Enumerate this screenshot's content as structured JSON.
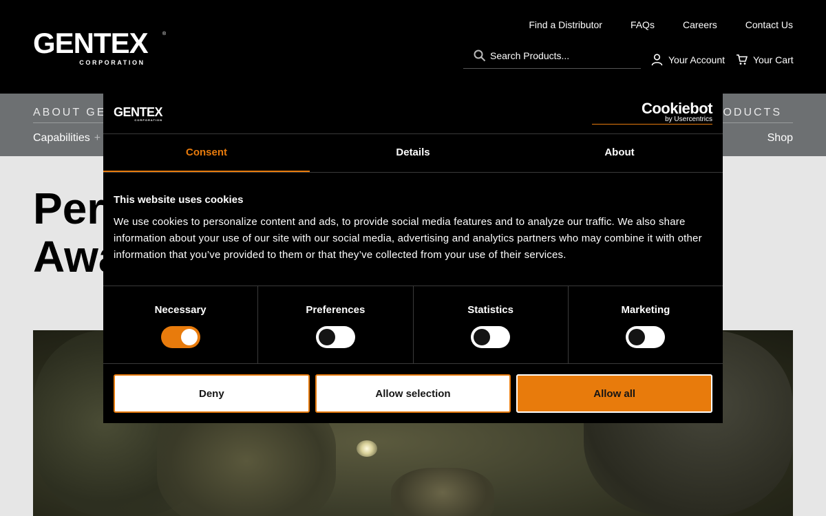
{
  "header": {
    "logo": {
      "word": "GENTEX",
      "sub": "CORPORATION",
      "reg": "®"
    },
    "utility_nav": [
      "Find a Distributor",
      "FAQs",
      "Careers",
      "Contact Us"
    ],
    "search": {
      "placeholder": "Search Products..."
    },
    "account_label": "Your Account",
    "cart_label": "Your Cart"
  },
  "nav": {
    "main_left": "ABOUT GE",
    "main_right": "ODUCTS",
    "sub_left": "Capabilities",
    "sub_left_plus": "+",
    "sub_right": "Shop"
  },
  "hero": {
    "title_line1": "Per",
    "title_line2": "Awa"
  },
  "cookie": {
    "logo": "GENTEX",
    "logo_sub": "CORPORATION",
    "brand": "Cookiebot",
    "brand_by": "by Usercentrics",
    "tabs": [
      "Consent",
      "Details",
      "About"
    ],
    "title": "This website uses cookies",
    "text": "We use cookies to personalize content and ads, to provide social media features and to analyze our traffic. We also share information about your use of our site with our social media, advertising and analytics partners who may combine it with other information that you’ve provided to them or that they’ve collected from your use of their services.",
    "toggles": [
      {
        "label": "Necessary",
        "on": true
      },
      {
        "label": "Preferences",
        "on": false
      },
      {
        "label": "Statistics",
        "on": false
      },
      {
        "label": "Marketing",
        "on": false
      }
    ],
    "buttons": {
      "deny": "Deny",
      "selection": "Allow selection",
      "allow_all": "Allow all"
    }
  },
  "colors": {
    "accent": "#e87b0c",
    "header_bg": "#000000",
    "nav_bg": "#6d7072",
    "page_bg": "#e6e6e6"
  }
}
